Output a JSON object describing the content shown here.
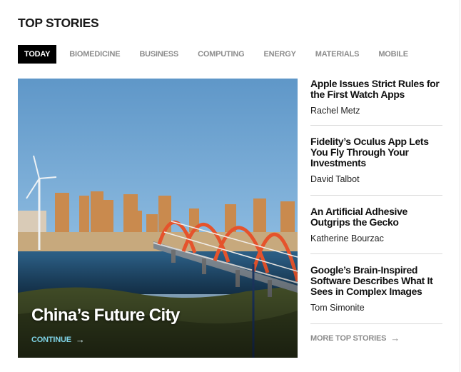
{
  "header": {
    "title": "TOP STORIES"
  },
  "tabs": [
    {
      "label": "TODAY",
      "active": true
    },
    {
      "label": "BIOMEDICINE",
      "active": false
    },
    {
      "label": "BUSINESS",
      "active": false
    },
    {
      "label": "COMPUTING",
      "active": false
    },
    {
      "label": "ENERGY",
      "active": false
    },
    {
      "label": "MATERIALS",
      "active": false
    },
    {
      "label": "MOBILE",
      "active": false
    }
  ],
  "feature": {
    "title": "China’s Future City",
    "continue_label": "CONTINUE",
    "arrow_icon": "arrow-right-icon",
    "accent_color": "#7fd3e6"
  },
  "stories": [
    {
      "headline": "Apple Issues Strict Rules for the First Watch Apps",
      "author": "Rachel Metz"
    },
    {
      "headline": "Fidelity’s Oculus App Lets You Fly Through Your Investments",
      "author": "David Talbot"
    },
    {
      "headline": "An Artificial Adhesive Outgrips the Gecko",
      "author": "Katherine Bourzac"
    },
    {
      "headline": "Google’s Brain-Inspired Software Describes What It Sees in Complex Images",
      "author": "Tom Simonite"
    }
  ],
  "more_link": {
    "label": "MORE TOP STORIES",
    "arrow_icon": "arrow-right-icon"
  }
}
